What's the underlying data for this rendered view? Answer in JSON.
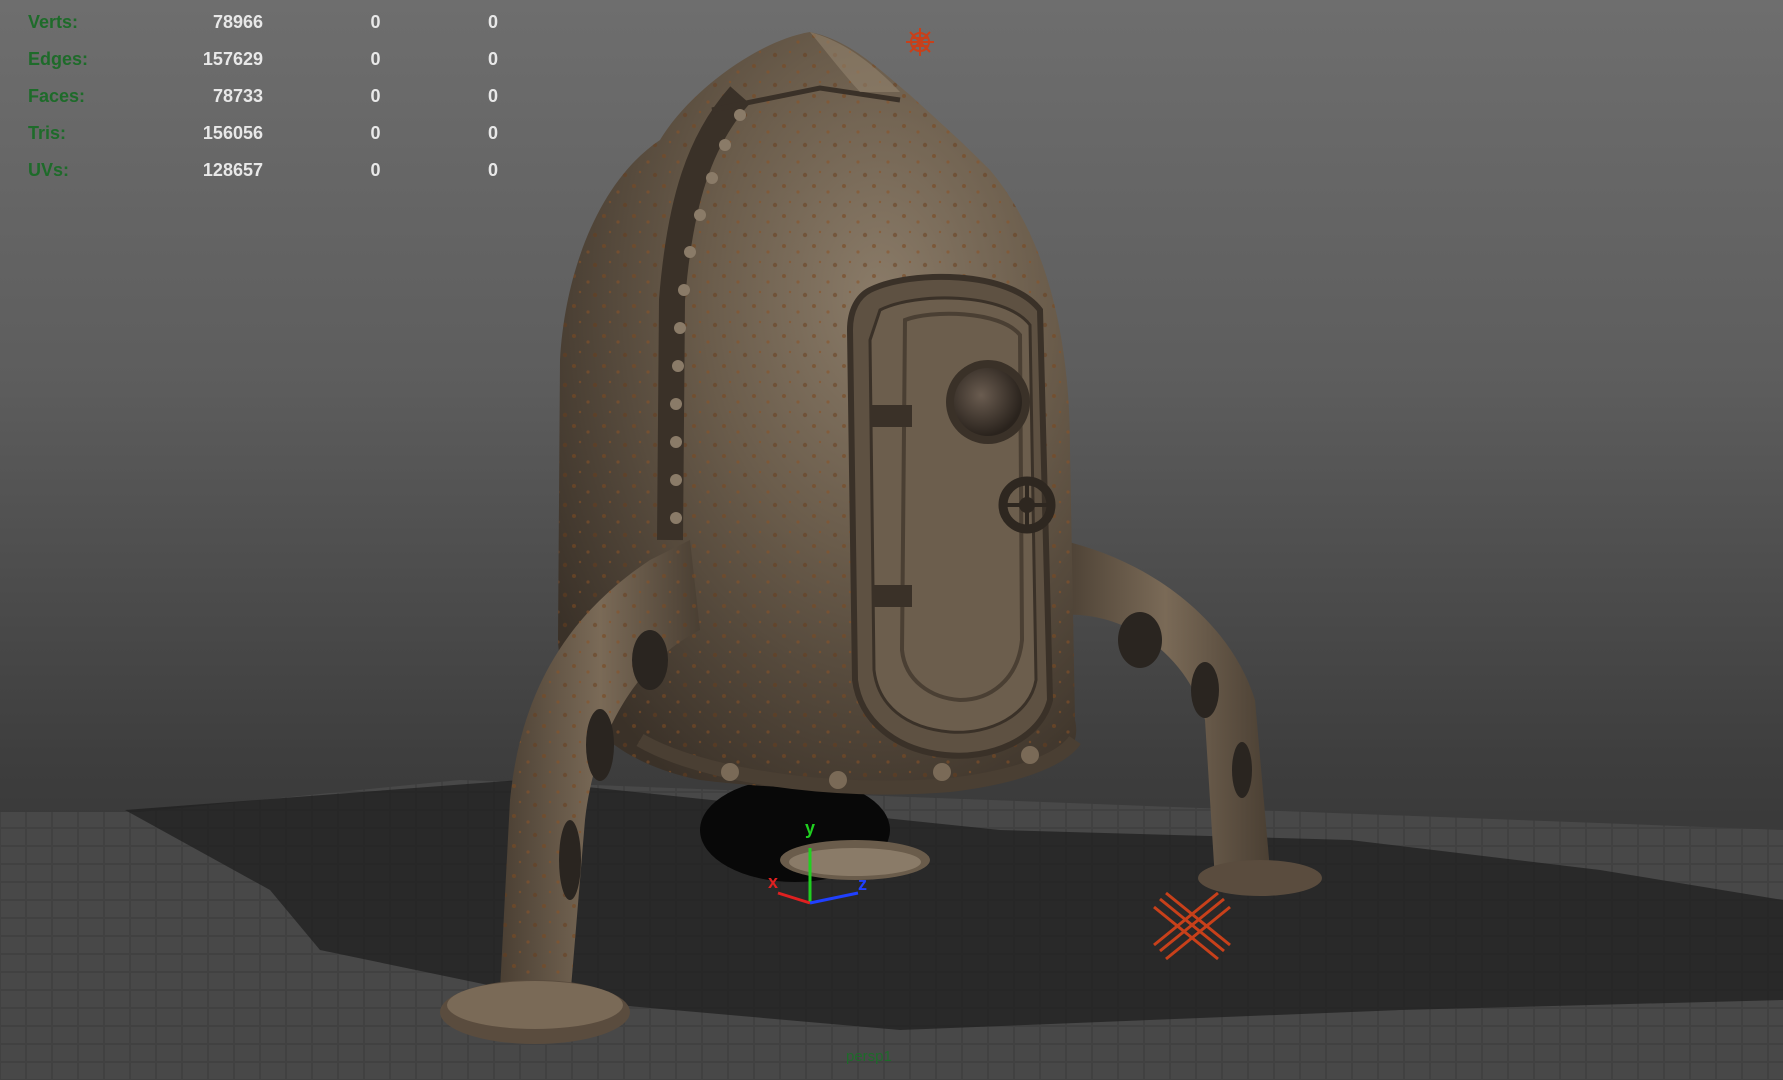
{
  "hud": {
    "rows": [
      {
        "label": "Verts:",
        "total": "78966",
        "selected": "0",
        "selected_2": "0"
      },
      {
        "label": "Edges:",
        "total": "157629",
        "selected": "0",
        "selected_2": "0"
      },
      {
        "label": "Faces:",
        "total": "78733",
        "selected": "0",
        "selected_2": "0"
      },
      {
        "label": "Tris:",
        "total": "156056",
        "selected": "0",
        "selected_2": "0"
      },
      {
        "label": "UVs:",
        "total": "128657",
        "selected": "0",
        "selected_2": "0"
      }
    ]
  },
  "viewport": {
    "camera_name": "persp1",
    "axes": {
      "x": "x",
      "y": "y",
      "z": "z"
    }
  },
  "colors": {
    "hud_label": "#1e6b2a",
    "hud_value": "#e8e8e8",
    "axis_x": "#e02020",
    "axis_y": "#20d020",
    "axis_z": "#2040ff",
    "light_icon": "#c8401a",
    "rust_metal": "#6a5a48"
  },
  "icons": [
    "point-light-icon",
    "directional-light-icon",
    "view-axis-gizmo-icon"
  ]
}
